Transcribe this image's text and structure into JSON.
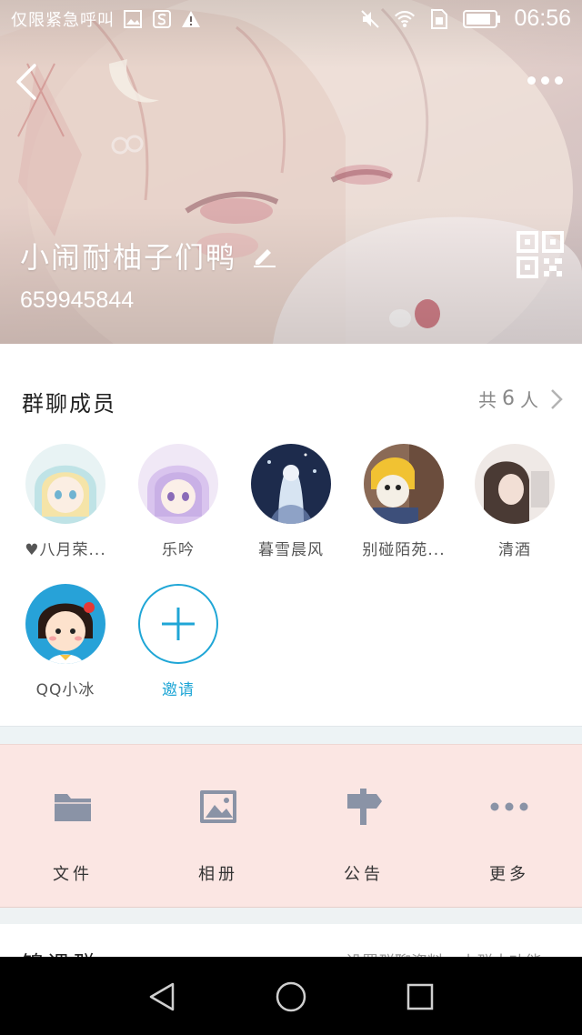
{
  "status_bar": {
    "carrier": "仅限紧急呼叫",
    "time": "06:56",
    "icons": [
      "image-icon",
      "s-app-icon",
      "warning-icon",
      "mute-icon",
      "wifi-icon",
      "sim-icon",
      "battery-icon"
    ]
  },
  "header": {
    "group_name": "小闹耐柚子们鸭",
    "group_id": "659945844",
    "icons": [
      "back-arrow-icon",
      "more-dots-icon",
      "edit-pencil-icon",
      "qr-code-icon"
    ]
  },
  "members": {
    "title": "群聊成员",
    "count_prefix": "共",
    "count": "6",
    "count_suffix": "人",
    "list": [
      {
        "name": "♥八月荣..."
      },
      {
        "name": "乐吟"
      },
      {
        "name": "暮雪晨风"
      },
      {
        "name": "别碰陌苑..."
      },
      {
        "name": "清酒"
      },
      {
        "name": "QQ小冰"
      }
    ],
    "invite_label": "邀请"
  },
  "shortcuts": [
    {
      "label": "文件",
      "icon": "folder-icon"
    },
    {
      "label": "相册",
      "icon": "image-icon"
    },
    {
      "label": "公告",
      "icon": "signpost-icon"
    },
    {
      "label": "更多",
      "icon": "more-dots-icon"
    }
  ],
  "next_row": {
    "title": "锦课群",
    "value": "设置群聊资料，小群大功能"
  },
  "colors": {
    "accent": "#1fa6d6",
    "shortcut_bg": "#fbe6e3",
    "icon_gray": "#8a93a6"
  }
}
